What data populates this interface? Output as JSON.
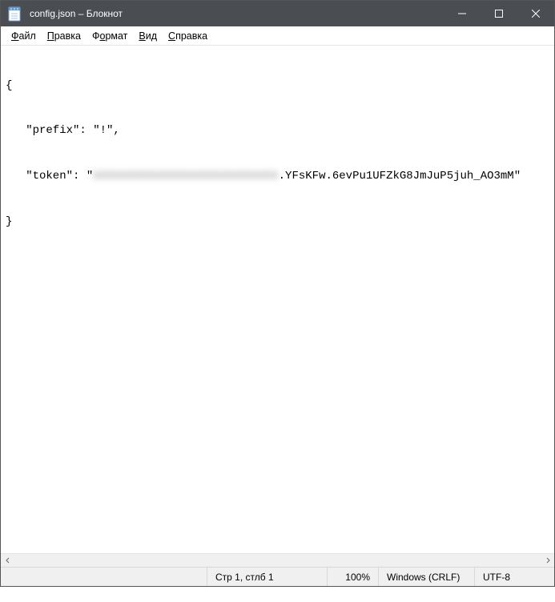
{
  "titlebar": {
    "title": "config.json – Блокнот"
  },
  "menu": {
    "file": "Файл",
    "file_u": "Ф",
    "edit": "Правка",
    "edit_u": "П",
    "format": "Формат",
    "format_u": "о",
    "view": "Вид",
    "view_u": "В",
    "help": "Справка",
    "help_u": "С"
  },
  "content": {
    "line1": "{",
    "line2_pre": "   \"prefix\": \"!\",",
    "line3_pre": "   \"token\": \"",
    "line3_blurred": "XXXXXXXXXXXXXXXXXXXXXXXXXX",
    "line3_post": ".YFsKFw.6evPu1UFZkG8JmJuP5juh_AO3mM\"",
    "line4": "}"
  },
  "statusbar": {
    "position": "Стр 1, стлб 1",
    "zoom": "100%",
    "line_ending": "Windows (CRLF)",
    "encoding": "UTF-8"
  }
}
